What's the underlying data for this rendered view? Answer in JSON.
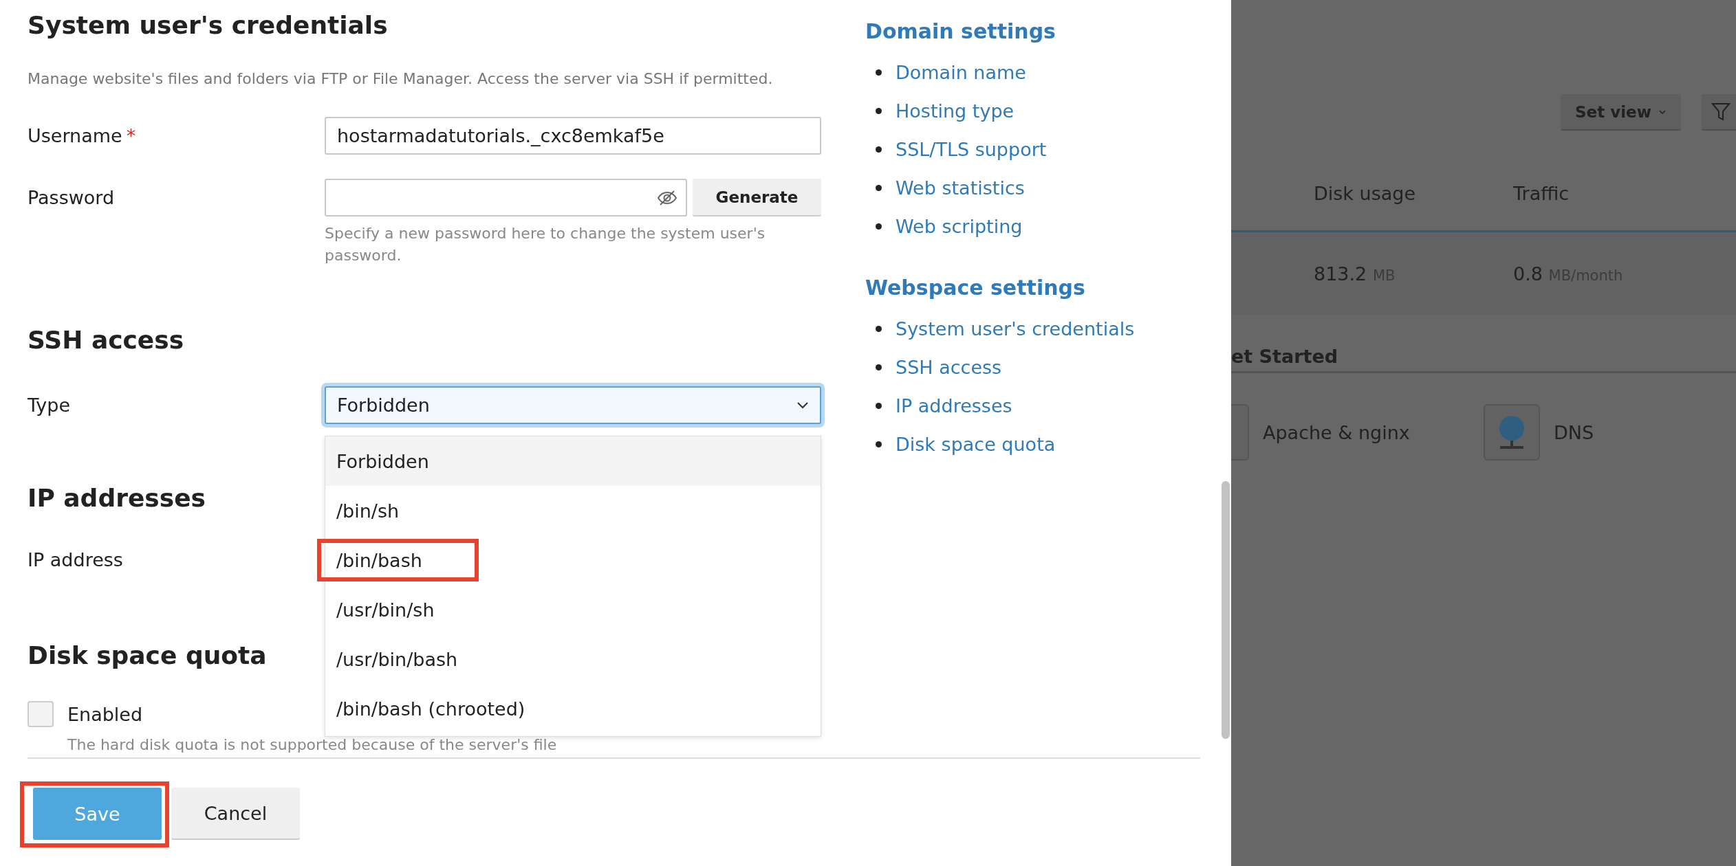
{
  "credentials": {
    "title": "System user's credentials",
    "description": "Manage website's files and folders via FTP or File Manager. Access the server via SSH if permitted.",
    "username": {
      "label": "Username",
      "required_mark": "*",
      "value": "hostarmadatutorials._cxc8emkaf5e"
    },
    "password": {
      "label": "Password",
      "generate_button": "Generate",
      "hint": "Specify a new password here to change the system user's password."
    }
  },
  "ssh": {
    "title": "SSH access",
    "type_label": "Type",
    "value": "Forbidden",
    "expanded": true,
    "options": [
      {
        "label": "Forbidden",
        "selected": true,
        "highlighted": false
      },
      {
        "label": "/bin/sh",
        "selected": false,
        "highlighted": false
      },
      {
        "label": "/bin/bash",
        "selected": false,
        "highlighted": true
      },
      {
        "label": "/usr/bin/sh",
        "selected": false,
        "highlighted": false
      },
      {
        "label": "/usr/bin/bash",
        "selected": false,
        "highlighted": false
      },
      {
        "label": "/bin/bash (chrooted)",
        "selected": false,
        "highlighted": false
      }
    ]
  },
  "ip": {
    "title": "IP addresses",
    "label": "IP address"
  },
  "quota": {
    "title": "Disk space quota",
    "checkbox": {
      "label": "Enabled",
      "checked": false
    },
    "hint": "The hard disk quota is not supported because of the server's file"
  },
  "buttons": [
    {
      "label": "Save",
      "kind": "primary",
      "highlighted": true
    },
    {
      "label": "Cancel",
      "kind": "secondary",
      "highlighted": false
    }
  ],
  "nav": [
    {
      "title": "Domain settings",
      "links": [
        "Domain name",
        "Hosting type",
        "SSL/TLS support",
        "Web statistics",
        "Web scripting"
      ]
    },
    {
      "title": "Webspace settings",
      "links": [
        "System user's credentials",
        "SSH access",
        "IP addresses",
        "Disk space quota"
      ]
    }
  ],
  "background": {
    "set_view": "Set view",
    "columns": [
      "Disk usage",
      "Traffic"
    ],
    "row": [
      {
        "value": "813.2",
        "unit": "MB"
      },
      {
        "value": "0.8",
        "unit": "MB/month"
      }
    ],
    "section_title": "et Started",
    "services": [
      "Apache & nginx",
      "DNS"
    ]
  }
}
